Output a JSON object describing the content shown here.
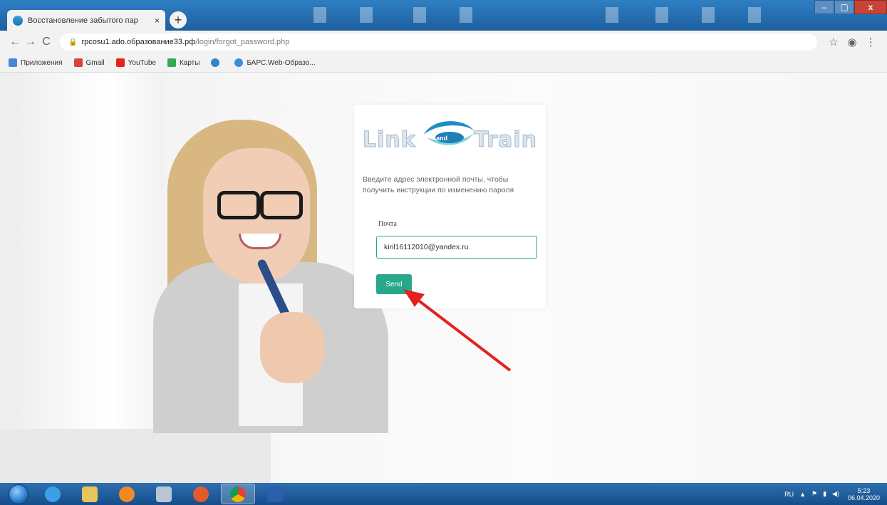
{
  "browser": {
    "tab_title": "Восстановление забытого пар",
    "tab_close": "×",
    "new_tab": "+",
    "window_controls": {
      "minimize": "–",
      "maximize": "▢",
      "close": "x"
    },
    "nav": {
      "back": "←",
      "forward": "→",
      "reload": "C"
    },
    "url_host": "rpcosu1.ado.образование33.рф",
    "url_path": "/login/forgot_password.php",
    "star": "☆",
    "profile": "◉",
    "menu": "⋮"
  },
  "bookmarks": [
    {
      "label": "Приложения",
      "icon": "apps-grid-icon",
      "color": "#4a86d8"
    },
    {
      "label": "Gmail",
      "icon": "gmail-icon",
      "color": "#d44638"
    },
    {
      "label": "YouTube",
      "icon": "youtube-icon",
      "color": "#e62117"
    },
    {
      "label": "Карты",
      "icon": "maps-icon",
      "color": "#34a853"
    },
    {
      "label": "",
      "icon": "site-favicon-icon",
      "color": "#2f86c8"
    },
    {
      "label": "БАРС.Web-Образо...",
      "icon": "bars-web-icon",
      "color": "#3b8be0"
    }
  ],
  "page": {
    "logo_left": "Link",
    "logo_and": "and",
    "logo_right": "Train",
    "description": "Введите адрес электронной почты, чтобы получить инструкции по изменению пароля",
    "email_label": "Почта",
    "email_value": "kiril16112010@yandex.ru",
    "send_label": "Send"
  },
  "taskbar": {
    "apps": [
      "internet-explorer-icon",
      "file-explorer-icon",
      "media-player-icon",
      "documents-icon",
      "firefox-icon",
      "chrome-icon",
      "word-icon"
    ],
    "tray_lang": "RU",
    "clock_time": "5:23",
    "clock_date": "06.04.2020"
  },
  "colors": {
    "accent": "#27a88a",
    "arrow": "#e5211f"
  }
}
